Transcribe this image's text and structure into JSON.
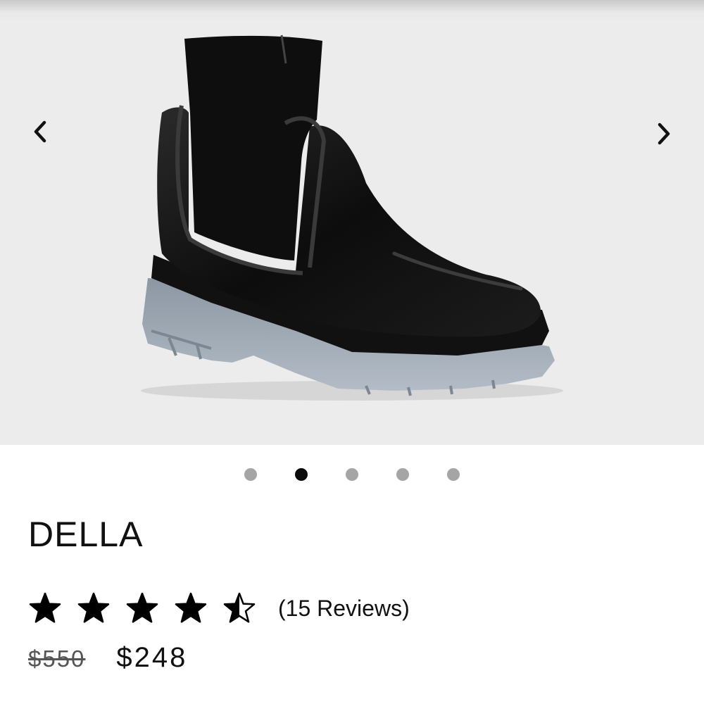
{
  "product": {
    "name": "DELLA",
    "rating": 4.5,
    "rating_max": 5,
    "reviews_label": "(15 Reviews)",
    "price_original": "$550",
    "price_sale": "$248"
  },
  "gallery": {
    "slide_count": 5,
    "active_index": 1,
    "background": "#ececec",
    "prev_icon": "chevron-left-icon",
    "next_icon": "chevron-right-icon"
  },
  "colors": {
    "dot_inactive": "#a5a5a5",
    "dot_active": "#0a0a0a",
    "text": "#111111"
  }
}
